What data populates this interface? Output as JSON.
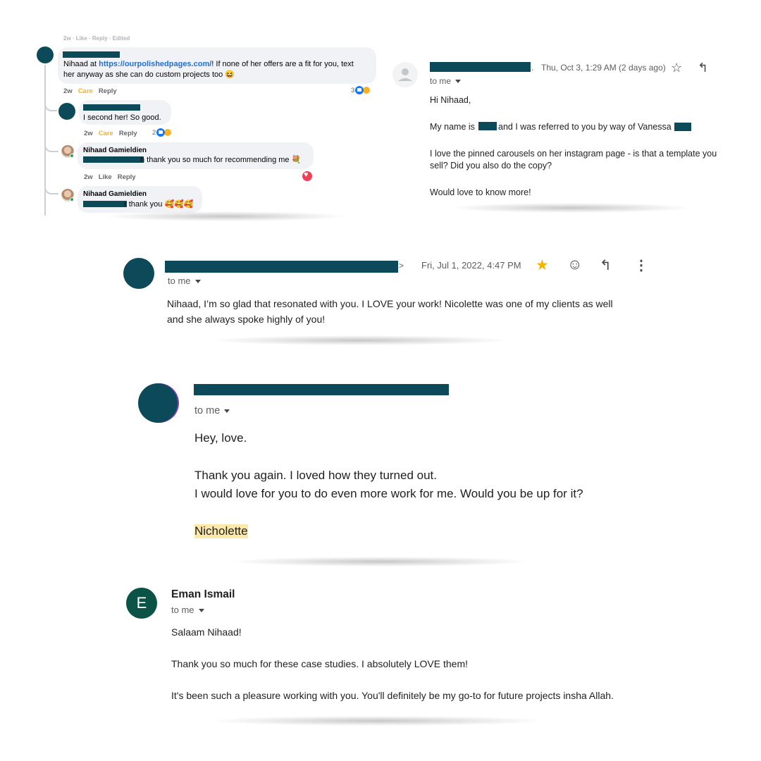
{
  "fb_thread": {
    "comment1": {
      "link_prefix": "Nihaad at ",
      "link": "https://ourpolishedpages.com/",
      "text_rest": "! If none of her offers are a fit for you, text",
      "text_line2": "her anyway as she can do custom projects too 😆",
      "meta": {
        "time": "2w",
        "react": "Care",
        "reply": "Reply"
      },
      "reaction_count": "3"
    },
    "comment2": {
      "text": "I second her! So good.",
      "meta": {
        "time": "2w",
        "react": "Care",
        "reply": "Reply"
      },
      "reaction_count": "2"
    },
    "comment3": {
      "author": "Nihaad Gamieldien",
      "text": "h thank you so much for recommending me 💐",
      "meta": {
        "time": "2w",
        "react": "Like",
        "reply": "Reply"
      }
    },
    "comment4": {
      "author": "Nihaad Gamieldien",
      "text": "r thank you 🥰🥰🥰"
    }
  },
  "email1": {
    "date": "Thu, Oct 3, 1:29 AM (2 days ago)",
    "to": "to me",
    "lines": [
      "Hi Nihaad,",
      "My name is",
      "and I was referred to you by way of Vanessa",
      "I love the pinned carousels on her instagram page - is that a template you",
      "sell? Did you also do the copy?",
      "Would love to know more!"
    ],
    "icons": {
      "star": "star-outline-icon",
      "reply": "reply-icon"
    }
  },
  "email2": {
    "date": "Fri, Jul 1, 2022, 4:47 PM",
    "to": "to me",
    "lines": [
      "Nihaad, I’m so glad that resonated with you. I LOVE your work! Nicolette was one of my clients as well",
      "and she always spoke highly of you!"
    ],
    "star_color": "#f4b400"
  },
  "email3": {
    "to": "to me",
    "lines": [
      "Hey, love.",
      "Thank you again. I loved how they turned out.",
      "I would love for you to do even more work for me. Would you be up for it?",
      "Nicholette"
    ]
  },
  "email4": {
    "avatar_letter": "E",
    "sender": "Eman Ismail",
    "to": "to me",
    "lines": [
      "Salaam Nihaad!",
      "Thank you so much for these case studies. I absolutely LOVE them!",
      "It's been such a pleasure working with you. You'll definitely be my go-to for future projects insha Allah."
    ],
    "avatar_color": "#0b5346"
  }
}
